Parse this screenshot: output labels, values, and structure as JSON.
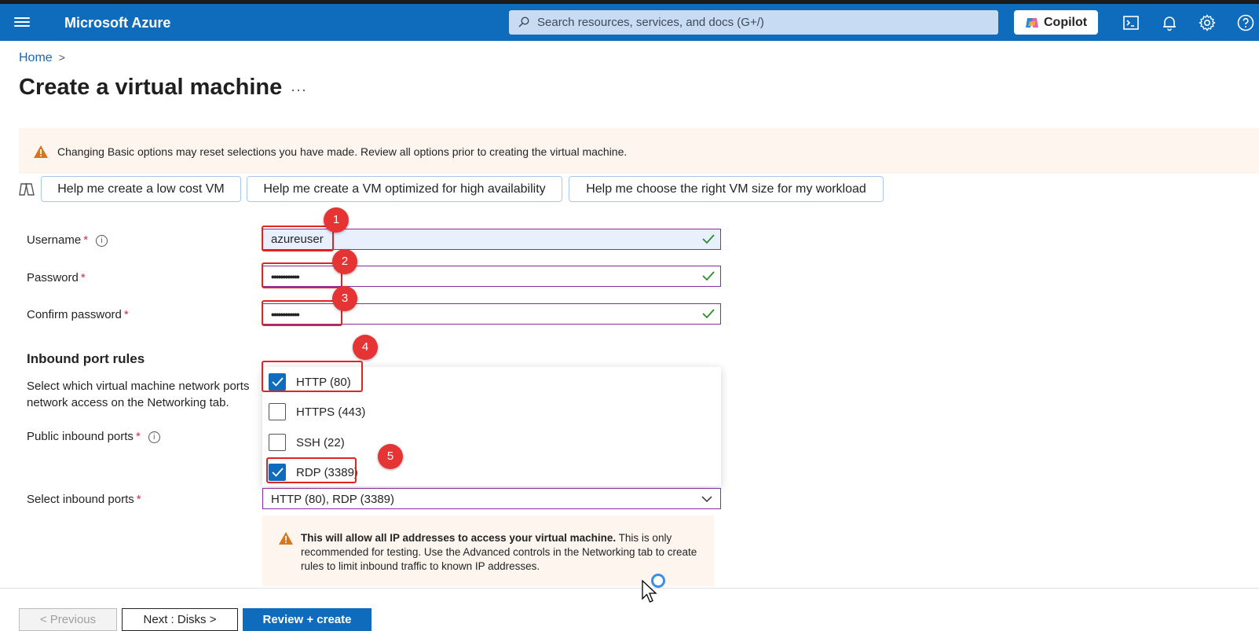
{
  "header": {
    "brand": "Microsoft Azure",
    "search_placeholder": "Search resources, services, and docs (G+/)",
    "copilot_label": "Copilot",
    "icons": [
      "cloud-shell-icon",
      "bell-icon",
      "gear-icon",
      "help-icon"
    ],
    "bar_color": "#0f6cbd"
  },
  "breadcrumb": {
    "home": "Home",
    "separator": ">"
  },
  "page": {
    "title": "Create a virtual machine",
    "more": "···"
  },
  "banner": {
    "text": "Changing Basic options may reset selections you have made. Review all options prior to creating the virtual machine."
  },
  "suggestions": [
    "Help me create a low cost VM",
    "Help me create a VM optimized for high availability",
    "Help me choose the right VM size for my workload"
  ],
  "form": {
    "username_label": "Username",
    "username_value": "azureuser",
    "password_label": "Password",
    "password_value": "••••••••••••",
    "confirm_label": "Confirm password",
    "confirm_value": "••••••••••••",
    "required_mark": "*"
  },
  "inbound": {
    "heading": "Inbound port rules",
    "description": "Select which virtual machine network ports ... network access on the Networking tab.",
    "desc_line1": "Select which virtual machine network ports",
    "desc_line2": "network access on the Networking tab.",
    "public_label": "Public inbound ports",
    "select_label": "Select inbound ports",
    "selected_value": "HTTP (80), RDP (3389)",
    "options": [
      {
        "label": "HTTP (80)",
        "checked": true
      },
      {
        "label": "HTTPS (443)",
        "checked": false
      },
      {
        "label": "SSH (22)",
        "checked": false
      },
      {
        "label": "RDP (3389)",
        "checked": true
      }
    ]
  },
  "notice": {
    "bold": "This will allow all IP addresses to access your virtual machine.",
    "rest": " This is only recommended for testing.  Use the Advanced controls in the Networking tab to create rules to limit inbound traffic to known IP addresses."
  },
  "annotations": [
    "1",
    "2",
    "3",
    "4",
    "5"
  ],
  "footer": {
    "previous": "< Previous",
    "next": "Next : Disks >",
    "review": "Review + create"
  }
}
